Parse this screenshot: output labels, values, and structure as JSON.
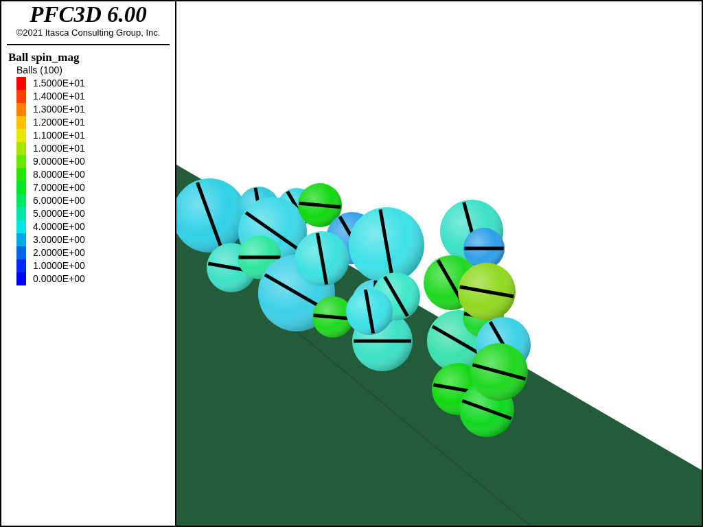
{
  "title": "PFC3D 6.00",
  "copyright": "©2021 Itasca Consulting Group, Inc.",
  "legend": {
    "title": "Ball spin_mag",
    "subtitle": "Balls (100)",
    "items": [
      {
        "label": "1.5000E+01",
        "color": "#ff0000"
      },
      {
        "label": "1.4000E+01",
        "color": "#ff4000"
      },
      {
        "label": "1.3000E+01",
        "color": "#ff8000"
      },
      {
        "label": "1.2000E+01",
        "color": "#ffc000"
      },
      {
        "label": "1.1000E+01",
        "color": "#e6e600"
      },
      {
        "label": "1.0000E+01",
        "color": "#a6e600"
      },
      {
        "label": "9.0000E+00",
        "color": "#66e600"
      },
      {
        "label": "8.0000E+00",
        "color": "#26e600"
      },
      {
        "label": "7.0000E+00",
        "color": "#00e626"
      },
      {
        "label": "6.0000E+00",
        "color": "#00e666"
      },
      {
        "label": "5.0000E+00",
        "color": "#00e6a6"
      },
      {
        "label": "4.0000E+00",
        "color": "#00e6e6"
      },
      {
        "label": "3.0000E+00",
        "color": "#00a6e6"
      },
      {
        "label": "2.0000E+00",
        "color": "#0066e6"
      },
      {
        "label": "1.0000E+00",
        "color": "#0026ff"
      },
      {
        "label": "0.0000E+00",
        "color": "#0000ff"
      }
    ]
  }
}
